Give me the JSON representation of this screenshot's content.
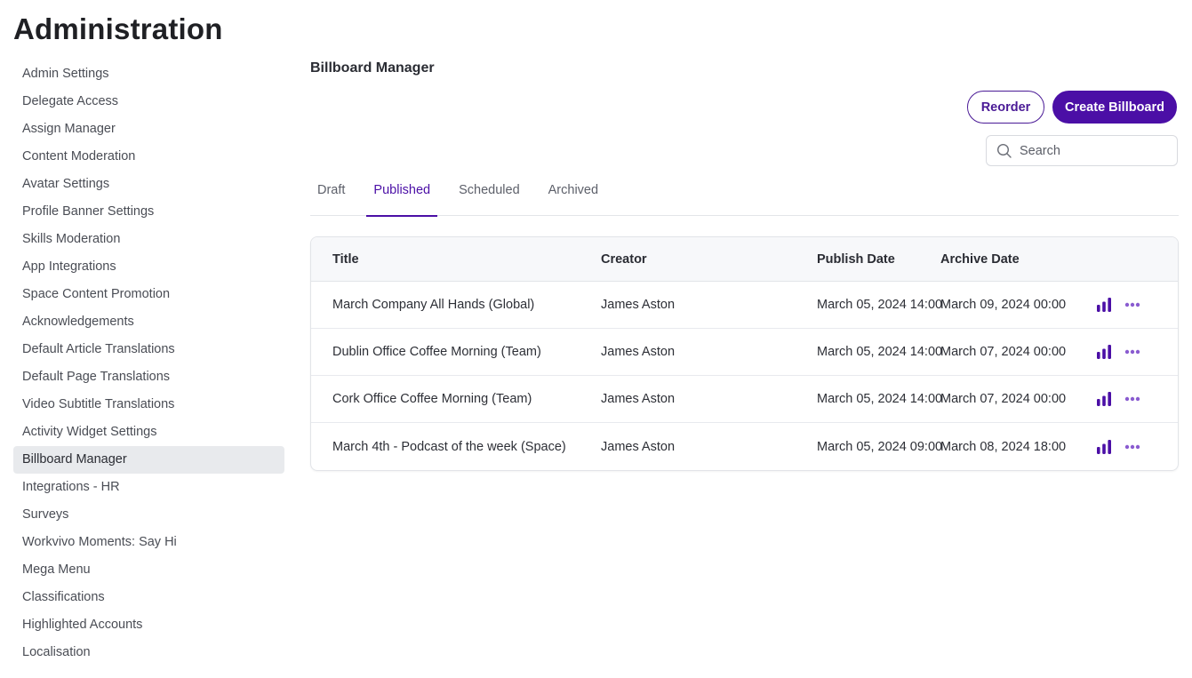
{
  "page": {
    "title": "Administration"
  },
  "sidebar": {
    "items": [
      {
        "label": "Admin Settings",
        "active": false
      },
      {
        "label": "Delegate Access",
        "active": false
      },
      {
        "label": "Assign Manager",
        "active": false
      },
      {
        "label": "Content Moderation",
        "active": false
      },
      {
        "label": "Avatar Settings",
        "active": false
      },
      {
        "label": "Profile Banner Settings",
        "active": false
      },
      {
        "label": "Skills Moderation",
        "active": false
      },
      {
        "label": "App Integrations",
        "active": false
      },
      {
        "label": "Space Content Promotion",
        "active": false
      },
      {
        "label": "Acknowledgements",
        "active": false
      },
      {
        "label": "Default Article Translations",
        "active": false
      },
      {
        "label": "Default Page Translations",
        "active": false
      },
      {
        "label": "Video Subtitle Translations",
        "active": false
      },
      {
        "label": "Activity Widget Settings",
        "active": false
      },
      {
        "label": "Billboard Manager",
        "active": true
      },
      {
        "label": "Integrations - HR",
        "active": false
      },
      {
        "label": "Surveys",
        "active": false
      },
      {
        "label": "Workvivo Moments: Say Hi",
        "active": false
      },
      {
        "label": "Mega Menu",
        "active": false
      },
      {
        "label": "Classifications",
        "active": false
      },
      {
        "label": "Highlighted Accounts",
        "active": false
      },
      {
        "label": "Localisation",
        "active": false
      }
    ]
  },
  "main": {
    "section_title": "Billboard Manager",
    "reorder_label": "Reorder",
    "create_label": "Create Billboard",
    "search_placeholder": "Search",
    "tabs": [
      {
        "label": "Draft",
        "active": false
      },
      {
        "label": "Published",
        "active": true
      },
      {
        "label": "Scheduled",
        "active": false
      },
      {
        "label": "Archived",
        "active": false
      }
    ],
    "table": {
      "headers": {
        "title": "Title",
        "creator": "Creator",
        "publish": "Publish Date",
        "archive": "Archive Date"
      },
      "rows": [
        {
          "title": "March Company All Hands (Global)",
          "creator": "James Aston",
          "publish": "March 05, 2024 14:00",
          "archive": "March 09, 2024 00:00"
        },
        {
          "title": "Dublin Office Coffee Morning (Team)",
          "creator": "James Aston",
          "publish": "March 05, 2024 14:00",
          "archive": "March 07, 2024 00:00"
        },
        {
          "title": "Cork Office Coffee Morning (Team)",
          "creator": "James Aston",
          "publish": "March 05, 2024 14:00",
          "archive": "March 07, 2024 00:00"
        },
        {
          "title": "March 4th - Podcast of the week (Space)",
          "creator": "James Aston",
          "publish": "March 05, 2024 09:00",
          "archive": "March 08, 2024 18:00"
        }
      ]
    }
  },
  "colors": {
    "accent": "#4b0fa6",
    "accent_light": "#8a5cd0",
    "active_bg": "#e8eaed"
  },
  "icons": {
    "search": "search-icon",
    "stats": "bar-chart-icon",
    "more": "more-horizontal-icon"
  }
}
